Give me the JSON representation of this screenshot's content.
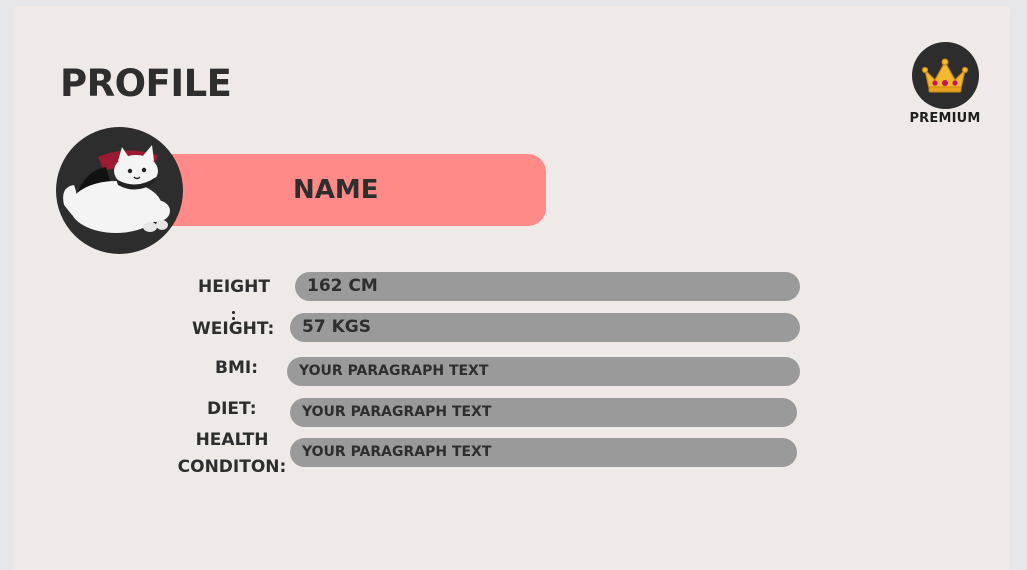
{
  "profile": {
    "title": "PROFILE",
    "name_placeholder": "NAME"
  },
  "premium": {
    "label": "PREMIUM",
    "icon": "crown-icon"
  },
  "avatar": {
    "icon": "white-cat-avatar"
  },
  "fields": {
    "height": {
      "label": "HEIGHT",
      "value": "162  CM"
    },
    "weight": {
      "label": "WEIGHT:",
      "value": "57 KGS"
    },
    "bmi": {
      "label": "BMI:",
      "value": "YOUR PARAGRAPH TEXT"
    },
    "diet": {
      "label": "DIET:",
      "value": "YOUR PARAGRAPH TEXT"
    },
    "health": {
      "label_line1": "HEALTH",
      "label_line2": "CONDITON:",
      "value": "YOUR PARAGRAPH TEXT"
    }
  },
  "colors": {
    "card_background": "#efeae7",
    "name_pill": "#ff8a87",
    "field_pill": "#9a9a9a",
    "text": "#2e2e2e",
    "avatar_background": "#2d2d2d",
    "crown_gold": "#f5b82e",
    "crown_jewel": "#c2185b"
  }
}
